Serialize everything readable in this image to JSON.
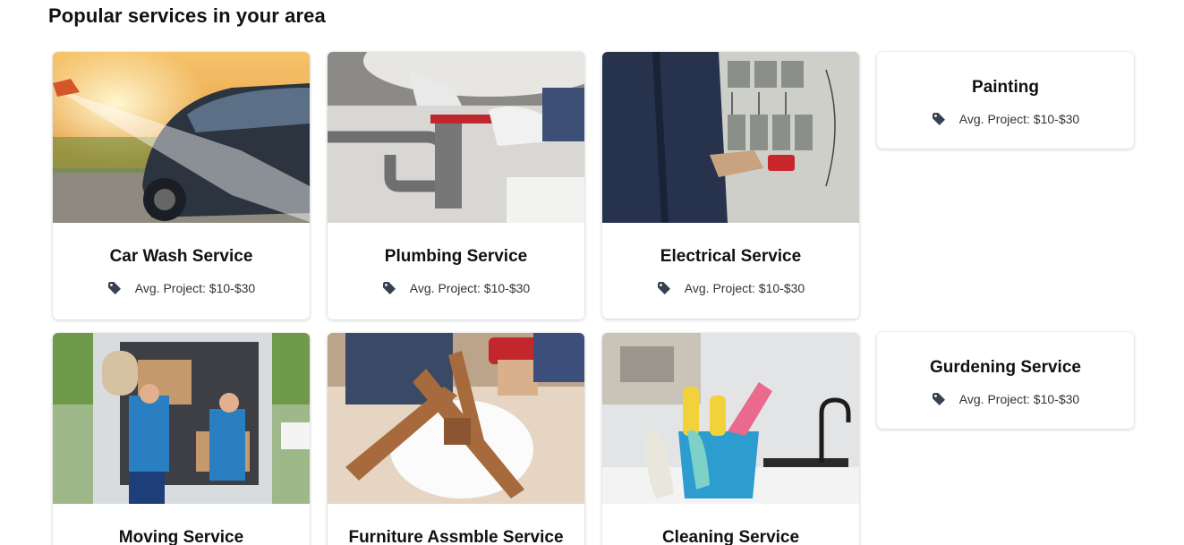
{
  "section": {
    "title": "Popular services in your area"
  },
  "meta_label": "Avg. Project: $10-$30",
  "services": [
    {
      "name": "Car Wash Service",
      "image": "car-wash-photo"
    },
    {
      "name": "Plumbing Service",
      "image": "plumbing-photo"
    },
    {
      "name": "Electrical Service",
      "image": "electrical-photo"
    },
    {
      "name": "Painting",
      "image": ""
    },
    {
      "name": "Moving Service",
      "image": "moving-photo"
    },
    {
      "name": "Furniture Assmble Service",
      "image": "furniture-photo"
    },
    {
      "name": "Cleaning Service",
      "image": "cleaning-photo"
    },
    {
      "name": "Gurdening Service",
      "image": ""
    }
  ],
  "icons": {
    "price": "tag-icon"
  },
  "colors": {
    "icon": "#374151",
    "title": "#111111",
    "meta_text": "#333333"
  }
}
